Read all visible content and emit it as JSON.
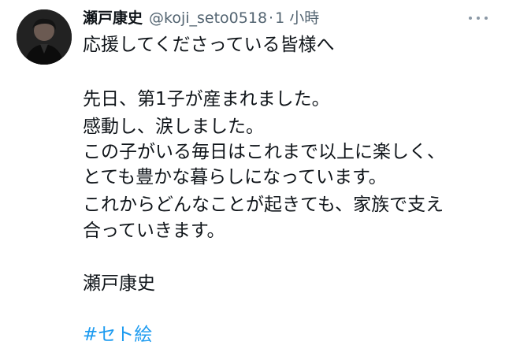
{
  "tweet": {
    "author": {
      "display_name": "瀬戸康史",
      "handle": "@koji_seto0518",
      "avatar_icon": "profile-photo-avatar"
    },
    "separator": "·",
    "timestamp": "1 小時",
    "more_icon": "more-horizontal-icon",
    "lines": [
      "応援してくださっている皆様へ",
      "先日、第1子が産まれました。",
      "感動し、涙しました。",
      "この子がいる毎日はこれまで以上に楽しく、",
      "とても豊かな暮らしになっています。",
      "これからどんなことが起きても、家族で支え",
      "合っていきます。",
      "瀬戸康史"
    ],
    "hashtag": "#セト絵",
    "colors": {
      "text": "#0f1419",
      "secondary": "#536471",
      "link": "#1d9bf0",
      "background": "#ffffff"
    }
  }
}
